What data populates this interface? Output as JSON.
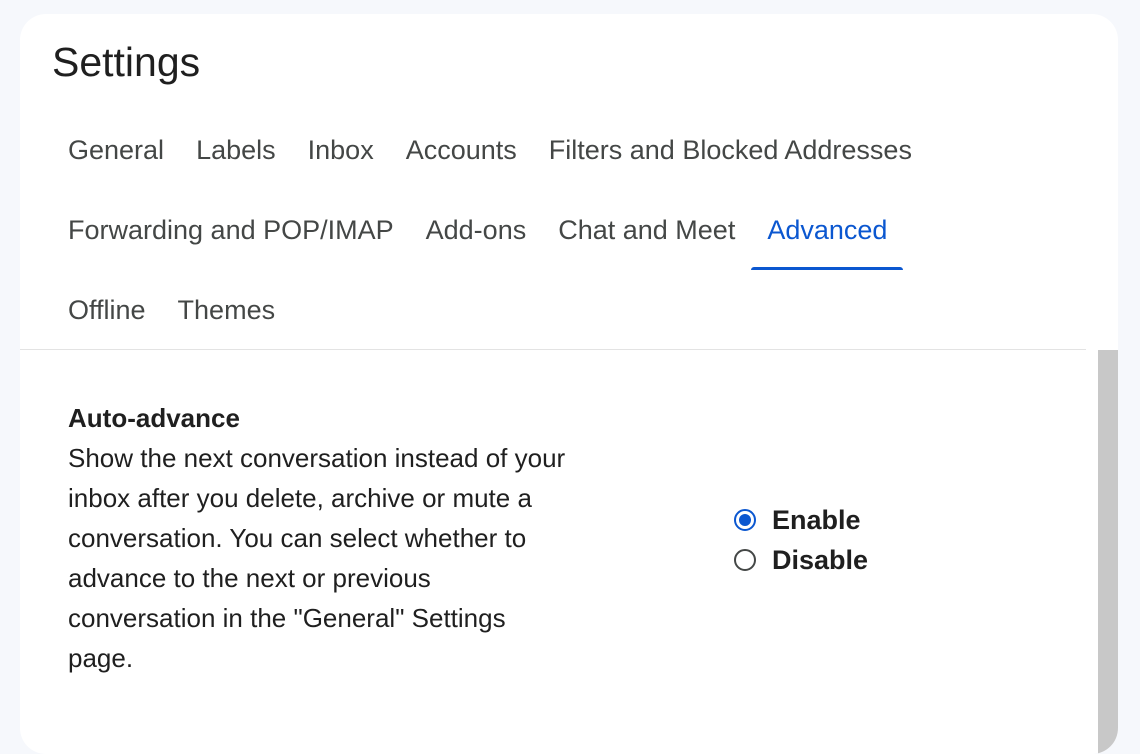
{
  "page": {
    "title": "Settings"
  },
  "tabs": {
    "rows": [
      [
        {
          "label": "General",
          "active": false
        },
        {
          "label": "Labels",
          "active": false
        },
        {
          "label": "Inbox",
          "active": false
        },
        {
          "label": "Accounts",
          "active": false
        },
        {
          "label": "Filters and Blocked Addresses",
          "active": false
        }
      ],
      [
        {
          "label": "Forwarding and POP/IMAP",
          "active": false
        },
        {
          "label": "Add-ons",
          "active": false
        },
        {
          "label": "Chat and Meet",
          "active": false
        },
        {
          "label": "Advanced",
          "active": true
        }
      ],
      [
        {
          "label": "Offline",
          "active": false
        },
        {
          "label": "Themes",
          "active": false
        }
      ]
    ]
  },
  "auto_advance": {
    "title": "Auto-advance",
    "description": "Show the next conversation instead of your inbox after you delete, archive or mute a conversation. You can select whether to advance to the next or previous conversation in the \"General\" Settings page.",
    "options": [
      {
        "label": "Enable",
        "selected": true
      },
      {
        "label": "Disable",
        "selected": false
      }
    ]
  },
  "colors": {
    "accent": "#0b57d0",
    "background": "#f6f8fc",
    "panel": "#ffffff",
    "text": "#1f1f1f",
    "tab_text": "#444746",
    "scrollbar": "#c8c8c8"
  }
}
